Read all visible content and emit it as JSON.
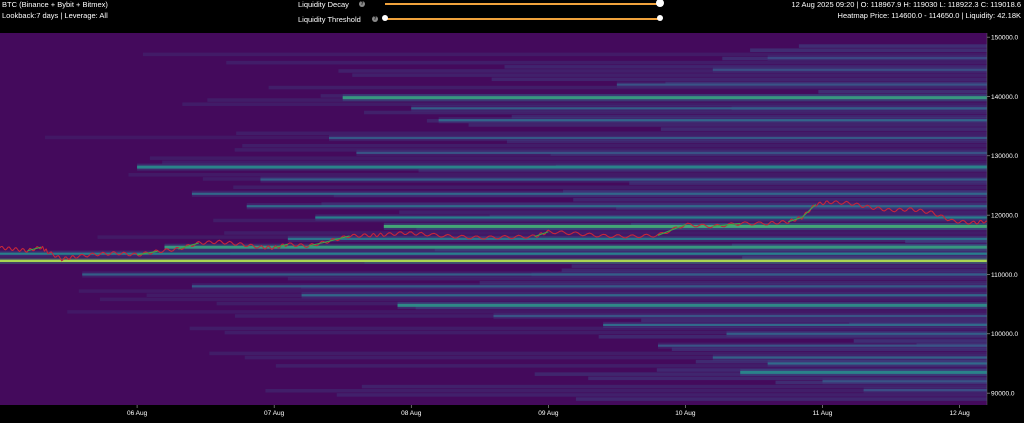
{
  "header": {
    "title": "BTC (Binance + Bybit + Bitmex)",
    "subtitle": "Lookback:7 days | Leverage: All",
    "ohlc": "12 Aug 2025 09:20 | O: 118967.9 H: 119030 L: 118922.3 C: 119018.6",
    "heatmap_info": "Heatmap Price: 114600.0 - 114650.0 | Liquidity: 42.18K"
  },
  "controls": {
    "decay_label": "Liquidity Decay",
    "threshold_label": "Liquidity Threshold",
    "decay_value": 1.0,
    "threshold_value": 1.0,
    "accent": "#f0a23c"
  },
  "chart_data": {
    "type": "heatmap",
    "title": "",
    "xlabel": "",
    "ylabel": "",
    "ylim": [
      88000,
      150700
    ],
    "xlim": [
      5.0,
      12.2
    ],
    "x_ticks": [
      {
        "x": 6,
        "label": "06 Aug"
      },
      {
        "x": 7,
        "label": "07 Aug"
      },
      {
        "x": 8,
        "label": "08 Aug"
      },
      {
        "x": 9,
        "label": "09 Aug"
      },
      {
        "x": 10,
        "label": "10 Aug"
      },
      {
        "x": 11,
        "label": "11 Aug"
      },
      {
        "x": 12,
        "label": "12 Aug"
      }
    ],
    "y_ticks": [
      {
        "y": 150000,
        "label": "150000.0"
      },
      {
        "y": 140000,
        "label": "140000.0"
      },
      {
        "y": 130000,
        "label": "130000.0"
      },
      {
        "y": 120000,
        "label": "120000.0"
      },
      {
        "y": 110000,
        "label": "110000.0"
      },
      {
        "y": 100000,
        "label": "100000.0"
      },
      {
        "y": 90000,
        "label": "90000.0"
      }
    ],
    "background_color": "#440a5c",
    "liquidity_bands": [
      {
        "price": 112300,
        "start": 5.0,
        "intensity": 1.0
      },
      {
        "price": 113500,
        "start": 5.0,
        "intensity": 0.5
      },
      {
        "price": 114600,
        "start": 6.2,
        "intensity": 0.62
      },
      {
        "price": 116000,
        "start": 7.1,
        "intensity": 0.45
      },
      {
        "price": 118100,
        "start": 7.8,
        "intensity": 0.7
      },
      {
        "price": 119600,
        "start": 7.3,
        "intensity": 0.5
      },
      {
        "price": 121500,
        "start": 6.8,
        "intensity": 0.4
      },
      {
        "price": 123600,
        "start": 6.4,
        "intensity": 0.38
      },
      {
        "price": 126000,
        "start": 6.9,
        "intensity": 0.35
      },
      {
        "price": 128100,
        "start": 6.0,
        "intensity": 0.52
      },
      {
        "price": 130500,
        "start": 7.6,
        "intensity": 0.3
      },
      {
        "price": 133000,
        "start": 7.4,
        "intensity": 0.32
      },
      {
        "price": 136000,
        "start": 8.2,
        "intensity": 0.38
      },
      {
        "price": 138000,
        "start": 8.0,
        "intensity": 0.35
      },
      {
        "price": 139800,
        "start": 7.5,
        "intensity": 0.62
      },
      {
        "price": 142000,
        "start": 9.5,
        "intensity": 0.3
      },
      {
        "price": 144500,
        "start": 10.2,
        "intensity": 0.28
      },
      {
        "price": 146500,
        "start": 10.6,
        "intensity": 0.25
      },
      {
        "price": 110000,
        "start": 5.6,
        "intensity": 0.35
      },
      {
        "price": 108000,
        "start": 6.4,
        "intensity": 0.32
      },
      {
        "price": 106500,
        "start": 7.2,
        "intensity": 0.38
      },
      {
        "price": 104800,
        "start": 7.9,
        "intensity": 0.55
      },
      {
        "price": 103000,
        "start": 8.6,
        "intensity": 0.3
      },
      {
        "price": 101500,
        "start": 9.4,
        "intensity": 0.4
      },
      {
        "price": 100000,
        "start": 10.3,
        "intensity": 0.35
      },
      {
        "price": 98000,
        "start": 9.8,
        "intensity": 0.3
      },
      {
        "price": 96000,
        "start": 10.2,
        "intensity": 0.36
      },
      {
        "price": 95000,
        "start": 10.6,
        "intensity": 0.4
      },
      {
        "price": 93500,
        "start": 10.4,
        "intensity": 0.52
      },
      {
        "price": 92000,
        "start": 11.0,
        "intensity": 0.3
      },
      {
        "price": 90500,
        "start": 11.3,
        "intensity": 0.28
      }
    ],
    "price_series": {
      "x": [
        5.0,
        5.1,
        5.2,
        5.3,
        5.35,
        5.45,
        5.55,
        5.7,
        5.85,
        6.0,
        6.15,
        6.3,
        6.45,
        6.6,
        6.75,
        6.9,
        7.0,
        7.1,
        7.25,
        7.4,
        7.55,
        7.7,
        7.8,
        7.95,
        8.1,
        8.3,
        8.5,
        8.7,
        8.9,
        9.0,
        9.2,
        9.4,
        9.6,
        9.8,
        10.0,
        10.2,
        10.4,
        10.6,
        10.75,
        10.85,
        10.95,
        11.05,
        11.2,
        11.35,
        11.5,
        11.65,
        11.8,
        11.95,
        12.1,
        12.2
      ],
      "y": [
        114500,
        114300,
        114000,
        114600,
        113800,
        112600,
        113000,
        113400,
        113600,
        113300,
        113900,
        114300,
        115300,
        115500,
        115100,
        114600,
        114500,
        115100,
        114800,
        115600,
        116500,
        116600,
        116700,
        117000,
        116800,
        116400,
        116200,
        116300,
        116400,
        117200,
        116900,
        116500,
        116400,
        116600,
        118400,
        118100,
        118600,
        118600,
        118900,
        119600,
        121800,
        122200,
        122000,
        121300,
        120800,
        121000,
        120400,
        119000,
        118700,
        119000
      ]
    },
    "price_color": "#c6263a",
    "rising_color": "#3aa84a"
  }
}
